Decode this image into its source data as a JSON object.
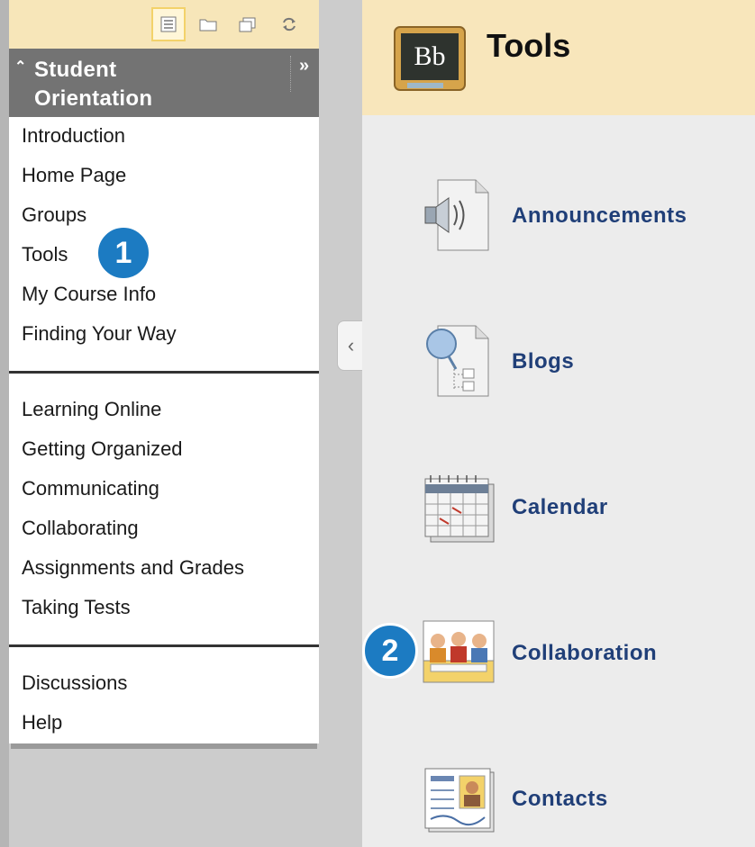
{
  "toolbar": {
    "buttons": [
      {
        "icon": "list-view-icon",
        "active": true
      },
      {
        "icon": "folder-view-icon",
        "active": false
      },
      {
        "icon": "window-view-icon",
        "active": false
      },
      {
        "icon": "refresh-icon",
        "active": false
      }
    ]
  },
  "course": {
    "collapse_glyph": "»",
    "title": "Student Orientation",
    "title_line1": "Student",
    "title_line2": "Orientation",
    "up_glyph": "«"
  },
  "menu": {
    "group1": [
      "Introduction",
      "Home Page",
      "Groups",
      "Tools",
      "My Course Info",
      "Finding Your Way"
    ],
    "group2": [
      "Learning Online",
      "Getting Organized",
      "Communicating",
      "Collaborating",
      "Assignments and Grades",
      "Taking Tests"
    ],
    "group3": [
      "Discussions",
      "Help"
    ]
  },
  "callouts": {
    "one": "1",
    "two": "2"
  },
  "content": {
    "logo_text": "Bb",
    "title": "Tools",
    "tools": [
      {
        "label": "Announcements",
        "icon": "announcements-icon"
      },
      {
        "label": "Blogs",
        "icon": "blogs-icon"
      },
      {
        "label": "Calendar",
        "icon": "calendar-icon"
      },
      {
        "label": "Collaboration",
        "icon": "collaboration-icon"
      },
      {
        "label": "Contacts",
        "icon": "contacts-icon"
      }
    ]
  },
  "colors": {
    "header_bg": "#f8e6bb",
    "course_header_bg": "#737373",
    "tool_label": "#203f78",
    "callout": "#1c7bc2"
  }
}
